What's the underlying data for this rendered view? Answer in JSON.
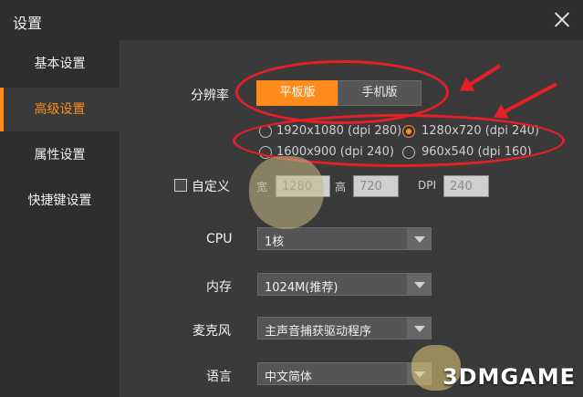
{
  "window": {
    "title": "设置"
  },
  "sidebar": {
    "items": [
      {
        "label": "基本设置",
        "active": false
      },
      {
        "label": "高级设置",
        "active": true
      },
      {
        "label": "属性设置",
        "active": false
      },
      {
        "label": "快捷键设置",
        "active": false
      }
    ]
  },
  "resolution": {
    "label": "分辨率",
    "segments": [
      "平板版",
      "手机版"
    ],
    "selected_segment": "平板版",
    "options": [
      "1920x1080 (dpi 280)",
      "1280x720 (dpi 240)",
      "1600x900 (dpi 240)",
      "960x540 (dpi 160)"
    ],
    "selected_option": "1280x720 (dpi 240)"
  },
  "custom": {
    "label": "自定义",
    "checked": false,
    "width_label": "宽",
    "width_value": "1280",
    "height_label": "高",
    "height_value": "720",
    "dpi_label": "DPI",
    "dpi_value": "240"
  },
  "cpu": {
    "label": "CPU",
    "value": "1核"
  },
  "memory": {
    "label": "内存",
    "value": "1024M(推荐)"
  },
  "mic": {
    "label": "麦克风",
    "value": "主声音捕获驱动程序"
  },
  "language": {
    "label": "语言",
    "value": "中文简体"
  },
  "watermark": {
    "text": "3DMGAME"
  },
  "colors": {
    "accent": "#ff8c1a",
    "annotation": "#e51f26"
  }
}
